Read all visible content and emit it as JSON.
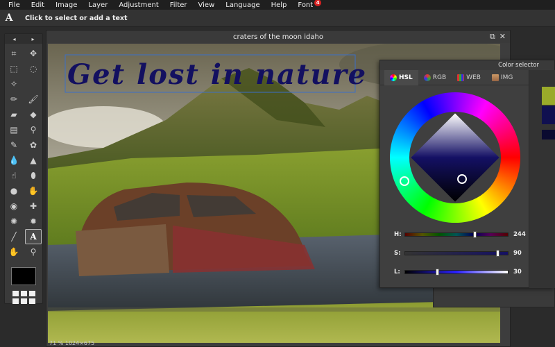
{
  "menu": {
    "items": [
      "File",
      "Edit",
      "Image",
      "Layer",
      "Adjustment",
      "Filter",
      "View",
      "Language",
      "Help",
      "Font"
    ],
    "font_badge": "4"
  },
  "options": {
    "tool_icon": "A",
    "hint": "Click to select or add a text"
  },
  "toolbox": {
    "arrow_left": "◂",
    "arrow_right": "▸",
    "tools": [
      {
        "name": "crop-tool-icon",
        "glyph": "⌗"
      },
      {
        "name": "move-tool-icon",
        "glyph": "✥"
      },
      {
        "name": "marquee-tool-icon",
        "glyph": "⬚"
      },
      {
        "name": "lasso-tool-icon",
        "glyph": "◌"
      },
      {
        "name": "magic-wand-tool-icon",
        "glyph": "✧"
      },
      {
        "name": "empty-slot",
        "glyph": ""
      },
      {
        "name": "pencil-tool-icon",
        "glyph": "✏"
      },
      {
        "name": "brush-tool-icon",
        "glyph": "🖌"
      },
      {
        "name": "eraser-tool-icon",
        "glyph": "▰"
      },
      {
        "name": "paint-bucket-tool-icon",
        "glyph": "◆"
      },
      {
        "name": "gradient-tool-icon",
        "glyph": "▤"
      },
      {
        "name": "stamp-tool-icon",
        "glyph": "⚲"
      },
      {
        "name": "color-replace-tool-icon",
        "glyph": "✎"
      },
      {
        "name": "drawing-tool-icon",
        "glyph": "✿"
      },
      {
        "name": "blur-tool-icon",
        "glyph": "💧"
      },
      {
        "name": "sharpen-tool-icon",
        "glyph": "▲"
      },
      {
        "name": "smudge-tool-icon",
        "glyph": "☝"
      },
      {
        "name": "sponge-tool-icon",
        "glyph": "⬮"
      },
      {
        "name": "dodge-tool-icon",
        "glyph": "●"
      },
      {
        "name": "burn-tool-icon",
        "glyph": "✋"
      },
      {
        "name": "red-eye-tool-icon",
        "glyph": "◉"
      },
      {
        "name": "spot-heal-tool-icon",
        "glyph": "✚"
      },
      {
        "name": "bloat-tool-icon",
        "glyph": "✺"
      },
      {
        "name": "pinch-tool-icon",
        "glyph": "✹"
      },
      {
        "name": "color-picker-tool-icon",
        "glyph": "╱"
      },
      {
        "name": "type-tool-icon",
        "glyph": "A"
      },
      {
        "name": "hand-tool-icon",
        "glyph": "✋"
      },
      {
        "name": "zoom-tool-icon",
        "glyph": "⚲"
      }
    ],
    "active_index": 25,
    "primary_color": "#000000"
  },
  "document": {
    "title": "craters of the moon idaho",
    "restore_glyph": "⧉",
    "close_glyph": "✕",
    "text_layer": "Get lost in nature",
    "status": "71 %  1024×675"
  },
  "color_selector": {
    "title": "Color selector",
    "tabs": [
      {
        "label": "HSL",
        "icon": "hsl-icon"
      },
      {
        "label": "RGB",
        "icon": "rgb-icon"
      },
      {
        "label": "WEB",
        "icon": "web-icon"
      },
      {
        "label": "IMG",
        "icon": "img-icon"
      }
    ],
    "active_tab": 0,
    "h": {
      "label": "H:",
      "value": "244",
      "fraction": 0.678
    },
    "s": {
      "label": "S:",
      "value": "90",
      "fraction": 0.9
    },
    "l": {
      "label": "L:",
      "value": "30",
      "fraction": 0.3
    },
    "swatches": [
      "#9aaa2a",
      "#101050",
      "#0a0a30"
    ]
  },
  "colors": {
    "text_color": "#131060",
    "selection_border": "#3a6fc8"
  }
}
